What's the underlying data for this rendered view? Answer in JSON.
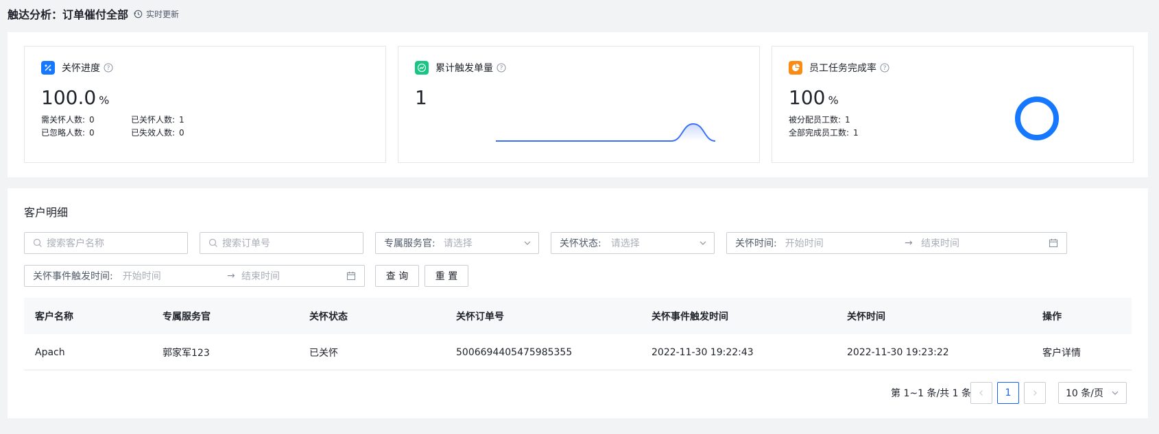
{
  "header": {
    "title": "触达分析：订单催付全部",
    "refresh_label": "实时更新"
  },
  "cards": {
    "care_progress": {
      "title": "关怀进度",
      "value": "100.0",
      "unit": "%",
      "stats": [
        {
          "label": "需关怀人数:",
          "value": "0"
        },
        {
          "label": "已关怀人数:",
          "value": "1"
        },
        {
          "label": "已忽略人数:",
          "value": "0"
        },
        {
          "label": "已失效人数:",
          "value": "0"
        }
      ],
      "icon_color": "#1677ff"
    },
    "triggered_orders": {
      "title": "累计触发单量",
      "value": "1",
      "icon_color": "#16c784",
      "sparkline": [
        0,
        0,
        0,
        0,
        0,
        0,
        0,
        0,
        0,
        1,
        0
      ]
    },
    "task_completion": {
      "title": "员工任务完成率",
      "value": "100",
      "unit": "%",
      "stats": [
        {
          "label": "被分配员工数:",
          "value": "1"
        },
        {
          "label": "全部完成员工数:",
          "value": "1"
        }
      ],
      "icon_color": "#fa8c16",
      "completion": 1.0
    }
  },
  "detail": {
    "title": "客户明细",
    "filters": {
      "customer_name_placeholder": "搜索客户名称",
      "order_no_placeholder": "搜索订单号",
      "service_officer_label": "专属服务官:",
      "service_officer_placeholder": "请选择",
      "care_status_label": "关怀状态:",
      "care_status_placeholder": "请选择",
      "care_time_label": "关怀时间:",
      "care_time_start": "开始时间",
      "care_time_end": "结束时间",
      "trigger_time_label": "关怀事件触发时间:",
      "trigger_time_start": "开始时间",
      "trigger_time_end": "结束时间"
    },
    "buttons": {
      "query": "查 询",
      "reset": "重 置"
    },
    "table": {
      "columns": [
        "客户名称",
        "专属服务官",
        "关怀状态",
        "关怀订单号",
        "关怀事件触发时间",
        "关怀时间",
        "操作"
      ],
      "rows": [
        {
          "customer": "Apach",
          "officer": "郭家军123",
          "status": "已关怀",
          "order_no": "5006694405475985355",
          "trigger_time": "2022-11-30 19:22:43",
          "care_time": "2022-11-30 19:23:22",
          "action": "客户详情"
        }
      ]
    },
    "pagination": {
      "summary": "第 1~1 条/共 1 条",
      "current_page": "1",
      "page_size": "10 条/页"
    }
  },
  "colors": {
    "primary": "#165dff",
    "chart_line": "#3a6ff7"
  }
}
